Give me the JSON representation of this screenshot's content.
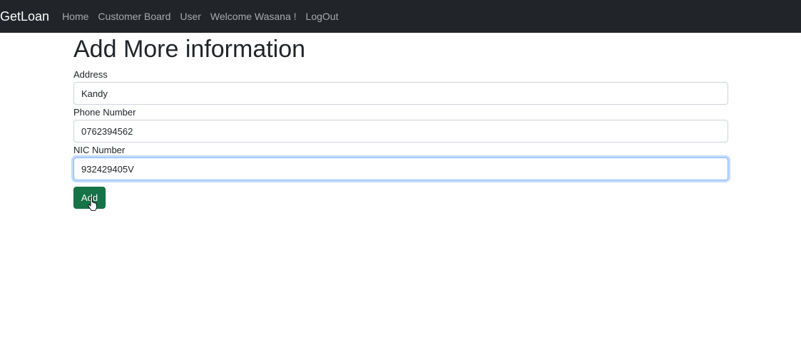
{
  "navbar": {
    "brand": "GetLoan",
    "links": [
      "Home",
      "Customer Board",
      "User",
      "Welcome Wasana !",
      "LogOut"
    ]
  },
  "page": {
    "title": "Add More information"
  },
  "form": {
    "address": {
      "label": "Address",
      "value": "Kandy"
    },
    "phone": {
      "label": "Phone Number",
      "value": "0762394562"
    },
    "nic": {
      "label": "NIC Number",
      "value": "932429405V"
    },
    "submit_label": "Add"
  },
  "colors": {
    "navbar_bg": "#212529",
    "button_bg": "#157347",
    "focus_border": "#86b7fe"
  }
}
